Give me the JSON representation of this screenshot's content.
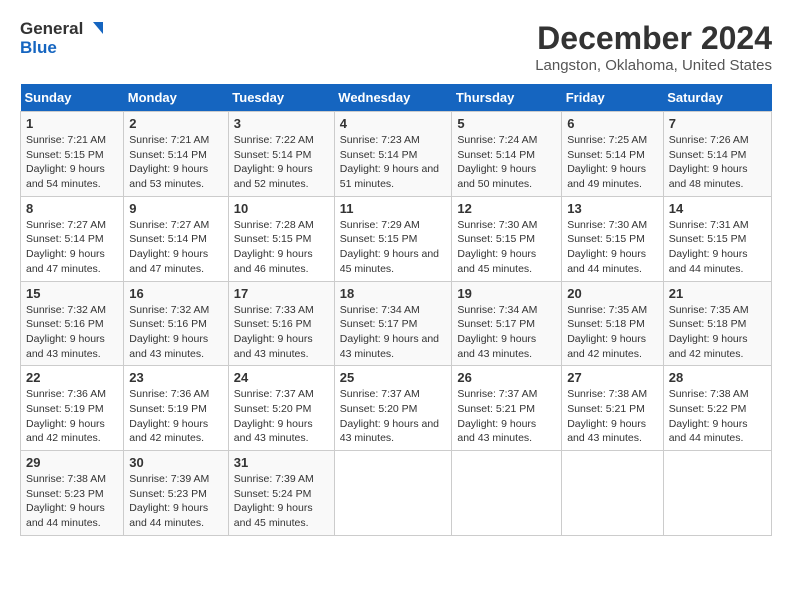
{
  "logo": {
    "line1": "General",
    "line2": "Blue"
  },
  "title": "December 2024",
  "subtitle": "Langston, Oklahoma, United States",
  "days_of_week": [
    "Sunday",
    "Monday",
    "Tuesday",
    "Wednesday",
    "Thursday",
    "Friday",
    "Saturday"
  ],
  "weeks": [
    [
      {
        "day": "1",
        "sunrise": "7:21 AM",
        "sunset": "5:15 PM",
        "daylight": "9 hours and 54 minutes."
      },
      {
        "day": "2",
        "sunrise": "7:21 AM",
        "sunset": "5:14 PM",
        "daylight": "9 hours and 53 minutes."
      },
      {
        "day": "3",
        "sunrise": "7:22 AM",
        "sunset": "5:14 PM",
        "daylight": "9 hours and 52 minutes."
      },
      {
        "day": "4",
        "sunrise": "7:23 AM",
        "sunset": "5:14 PM",
        "daylight": "9 hours and 51 minutes."
      },
      {
        "day": "5",
        "sunrise": "7:24 AM",
        "sunset": "5:14 PM",
        "daylight": "9 hours and 50 minutes."
      },
      {
        "day": "6",
        "sunrise": "7:25 AM",
        "sunset": "5:14 PM",
        "daylight": "9 hours and 49 minutes."
      },
      {
        "day": "7",
        "sunrise": "7:26 AM",
        "sunset": "5:14 PM",
        "daylight": "9 hours and 48 minutes."
      }
    ],
    [
      {
        "day": "8",
        "sunrise": "7:27 AM",
        "sunset": "5:14 PM",
        "daylight": "9 hours and 47 minutes."
      },
      {
        "day": "9",
        "sunrise": "7:27 AM",
        "sunset": "5:14 PM",
        "daylight": "9 hours and 47 minutes."
      },
      {
        "day": "10",
        "sunrise": "7:28 AM",
        "sunset": "5:15 PM",
        "daylight": "9 hours and 46 minutes."
      },
      {
        "day": "11",
        "sunrise": "7:29 AM",
        "sunset": "5:15 PM",
        "daylight": "9 hours and 45 minutes."
      },
      {
        "day": "12",
        "sunrise": "7:30 AM",
        "sunset": "5:15 PM",
        "daylight": "9 hours and 45 minutes."
      },
      {
        "day": "13",
        "sunrise": "7:30 AM",
        "sunset": "5:15 PM",
        "daylight": "9 hours and 44 minutes."
      },
      {
        "day": "14",
        "sunrise": "7:31 AM",
        "sunset": "5:15 PM",
        "daylight": "9 hours and 44 minutes."
      }
    ],
    [
      {
        "day": "15",
        "sunrise": "7:32 AM",
        "sunset": "5:16 PM",
        "daylight": "9 hours and 43 minutes."
      },
      {
        "day": "16",
        "sunrise": "7:32 AM",
        "sunset": "5:16 PM",
        "daylight": "9 hours and 43 minutes."
      },
      {
        "day": "17",
        "sunrise": "7:33 AM",
        "sunset": "5:16 PM",
        "daylight": "9 hours and 43 minutes."
      },
      {
        "day": "18",
        "sunrise": "7:34 AM",
        "sunset": "5:17 PM",
        "daylight": "9 hours and 43 minutes."
      },
      {
        "day": "19",
        "sunrise": "7:34 AM",
        "sunset": "5:17 PM",
        "daylight": "9 hours and 43 minutes."
      },
      {
        "day": "20",
        "sunrise": "7:35 AM",
        "sunset": "5:18 PM",
        "daylight": "9 hours and 42 minutes."
      },
      {
        "day": "21",
        "sunrise": "7:35 AM",
        "sunset": "5:18 PM",
        "daylight": "9 hours and 42 minutes."
      }
    ],
    [
      {
        "day": "22",
        "sunrise": "7:36 AM",
        "sunset": "5:19 PM",
        "daylight": "9 hours and 42 minutes."
      },
      {
        "day": "23",
        "sunrise": "7:36 AM",
        "sunset": "5:19 PM",
        "daylight": "9 hours and 42 minutes."
      },
      {
        "day": "24",
        "sunrise": "7:37 AM",
        "sunset": "5:20 PM",
        "daylight": "9 hours and 43 minutes."
      },
      {
        "day": "25",
        "sunrise": "7:37 AM",
        "sunset": "5:20 PM",
        "daylight": "9 hours and 43 minutes."
      },
      {
        "day": "26",
        "sunrise": "7:37 AM",
        "sunset": "5:21 PM",
        "daylight": "9 hours and 43 minutes."
      },
      {
        "day": "27",
        "sunrise": "7:38 AM",
        "sunset": "5:21 PM",
        "daylight": "9 hours and 43 minutes."
      },
      {
        "day": "28",
        "sunrise": "7:38 AM",
        "sunset": "5:22 PM",
        "daylight": "9 hours and 44 minutes."
      }
    ],
    [
      {
        "day": "29",
        "sunrise": "7:38 AM",
        "sunset": "5:23 PM",
        "daylight": "9 hours and 44 minutes."
      },
      {
        "day": "30",
        "sunrise": "7:39 AM",
        "sunset": "5:23 PM",
        "daylight": "9 hours and 44 minutes."
      },
      {
        "day": "31",
        "sunrise": "7:39 AM",
        "sunset": "5:24 PM",
        "daylight": "9 hours and 45 minutes."
      },
      null,
      null,
      null,
      null
    ]
  ]
}
